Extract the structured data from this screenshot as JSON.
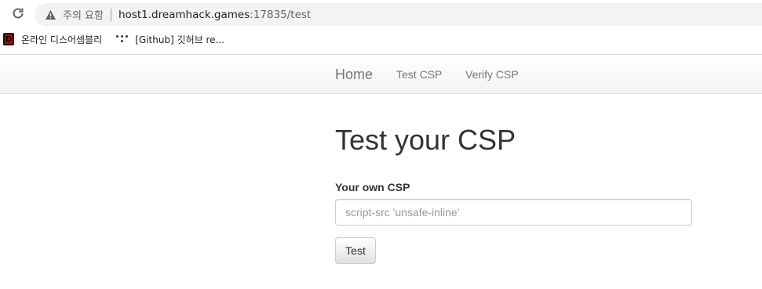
{
  "browser": {
    "security_label": "주의 요함",
    "url_host": "host1.dreamhack.games",
    "url_rest": ":17835/test",
    "icons": {
      "reload": "reload-icon",
      "warning": "warning-icon"
    }
  },
  "bookmarks": [
    {
      "label": "온라인 디스어셈블리",
      "favicon": "D"
    },
    {
      "label": "[Github] 깃허브 re..."
    }
  ],
  "navbar": {
    "brand": "Home",
    "links": [
      "Test CSP",
      "Verify CSP"
    ]
  },
  "main": {
    "title": "Test your CSP",
    "field_label": "Your own CSP",
    "input_placeholder": "script-src 'unsafe-inline'",
    "input_value": "",
    "button_label": "Test"
  },
  "colors": {
    "navbar_text": "#777777",
    "body_text": "#333333",
    "omnibox_bg": "#f1f3f4"
  }
}
